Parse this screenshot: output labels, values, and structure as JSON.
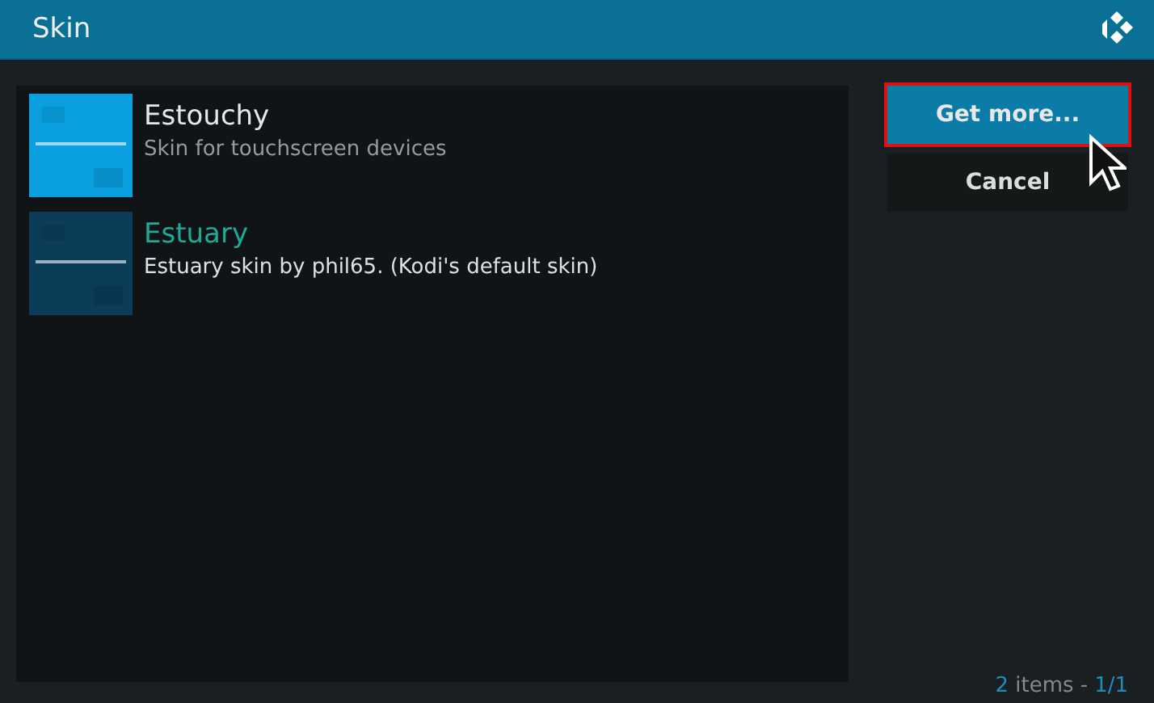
{
  "window": {
    "title": "Skin"
  },
  "skins": [
    {
      "name": "Estouchy",
      "description": "Skin for touchscreen devices",
      "current": false
    },
    {
      "name": "Estuary",
      "description": "Estuary skin by phil65. (Kodi's default skin)",
      "current": true
    }
  ],
  "buttons": [
    {
      "label": "Get more...",
      "focused": true,
      "outlined": true
    },
    {
      "label": "Cancel",
      "focused": false,
      "outlined": false
    }
  ],
  "footer": {
    "count": "2",
    "label": "items -",
    "page": "1/1"
  }
}
